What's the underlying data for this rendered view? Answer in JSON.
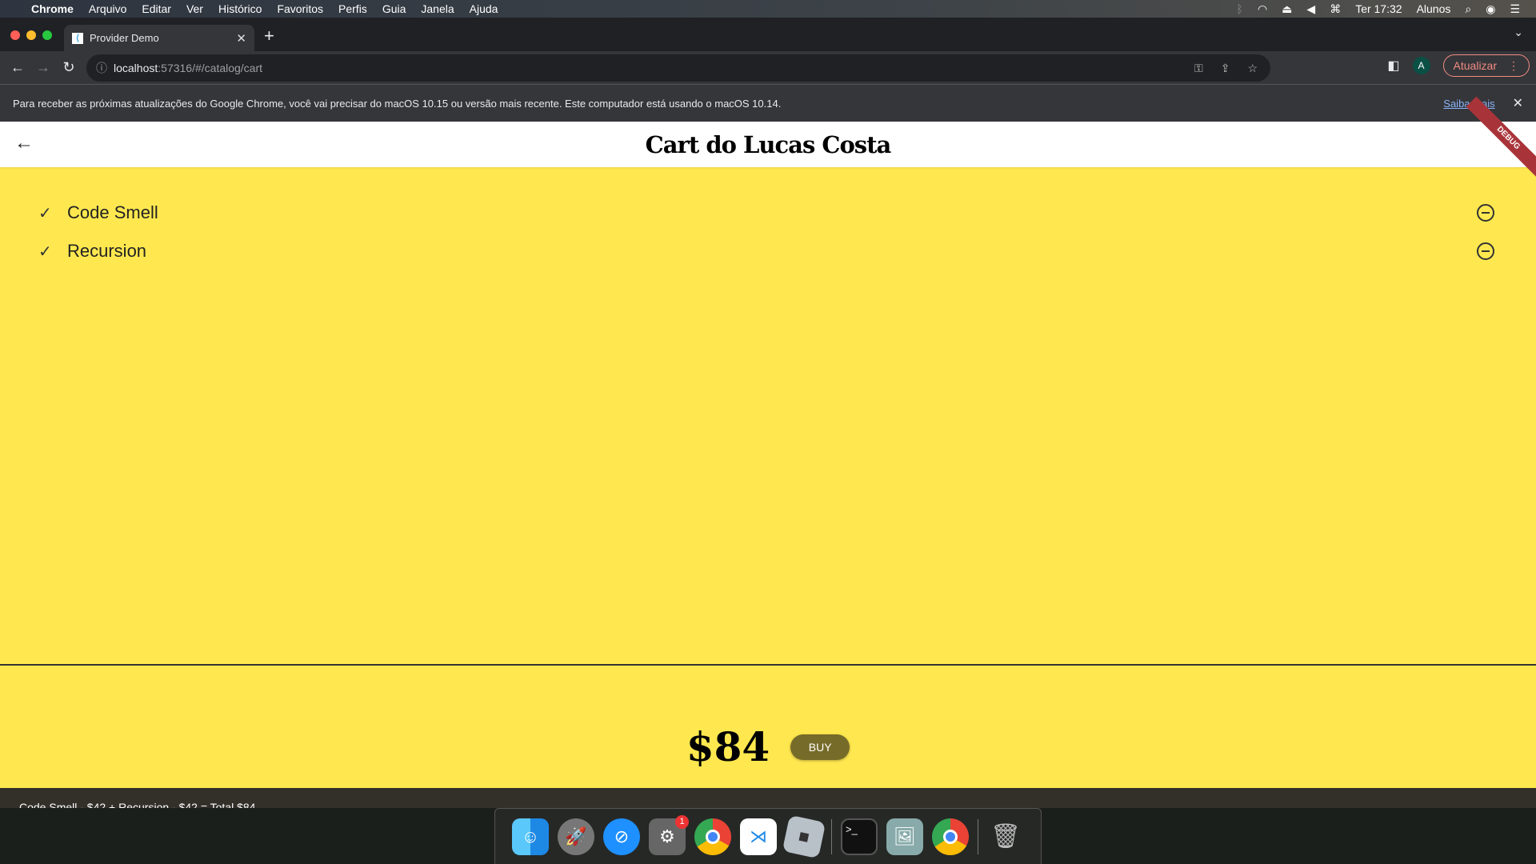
{
  "menubar": {
    "app": "Chrome",
    "items": [
      "Arquivo",
      "Editar",
      "Ver",
      "Histórico",
      "Favoritos",
      "Perfis",
      "Guia",
      "Janela",
      "Ajuda"
    ],
    "clock": "Ter 17:32",
    "user": "Alunos"
  },
  "browser": {
    "tab_title": "Provider Demo",
    "url_host": "localhost",
    "url_path": ":57316/#/catalog/cart",
    "profile_initial": "A",
    "update_label": "Atualizar",
    "infobar_text": "Para receber as próximas atualizações do Google Chrome, você vai precisar do macOS 10.15 ou versão mais recente. Este computador está usando o macOS 10.14.",
    "infobar_link": "Saiba mais"
  },
  "app": {
    "title": "Cart do Lucas Costa",
    "debug_banner": "DEBUG",
    "items": [
      {
        "name": "Code Smell"
      },
      {
        "name": "Recursion"
      }
    ],
    "total": "$84",
    "buy_label": "BUY",
    "snackbar": "Code Smell - $42 + Recursion - $42 = Total $84",
    "background_color": "#ffe84f",
    "button_color": "#766b29"
  },
  "dock": {
    "apps": [
      "finder",
      "launchpad",
      "safari",
      "system-preferences",
      "chrome",
      "vscode",
      "roblox",
      "terminal",
      "preview",
      "chrome",
      "trash"
    ],
    "system_preferences_badge": "1"
  }
}
